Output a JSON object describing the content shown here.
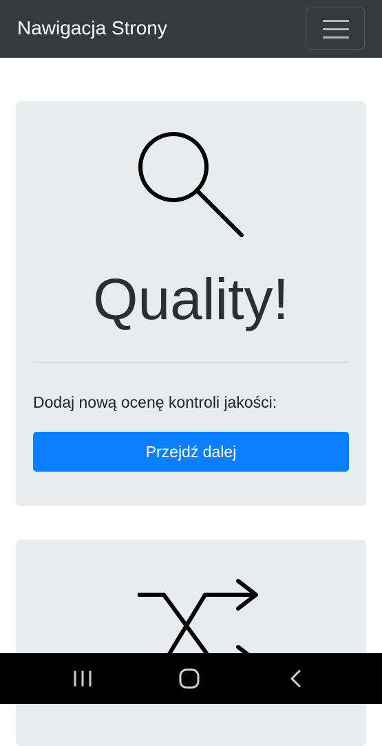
{
  "navbar": {
    "brand": "Nawigacja Strony",
    "toggler_icon": "hamburger-menu-icon"
  },
  "cards": [
    {
      "icon": "search-icon",
      "title": "Quality!",
      "lead": "Dodaj nową ocenę kontroli jakości:",
      "button_label": "Przejdź dalej"
    },
    {
      "icon": "shuffle-icon"
    }
  ],
  "system_nav": {
    "recents_icon": "recents-icon",
    "home_icon": "home-icon",
    "back_icon": "back-icon"
  },
  "colors": {
    "navbar_bg": "#343a40",
    "card_bg": "#e9ecef",
    "button_bg": "#0a80ff",
    "system_bar_bg": "#000000"
  }
}
